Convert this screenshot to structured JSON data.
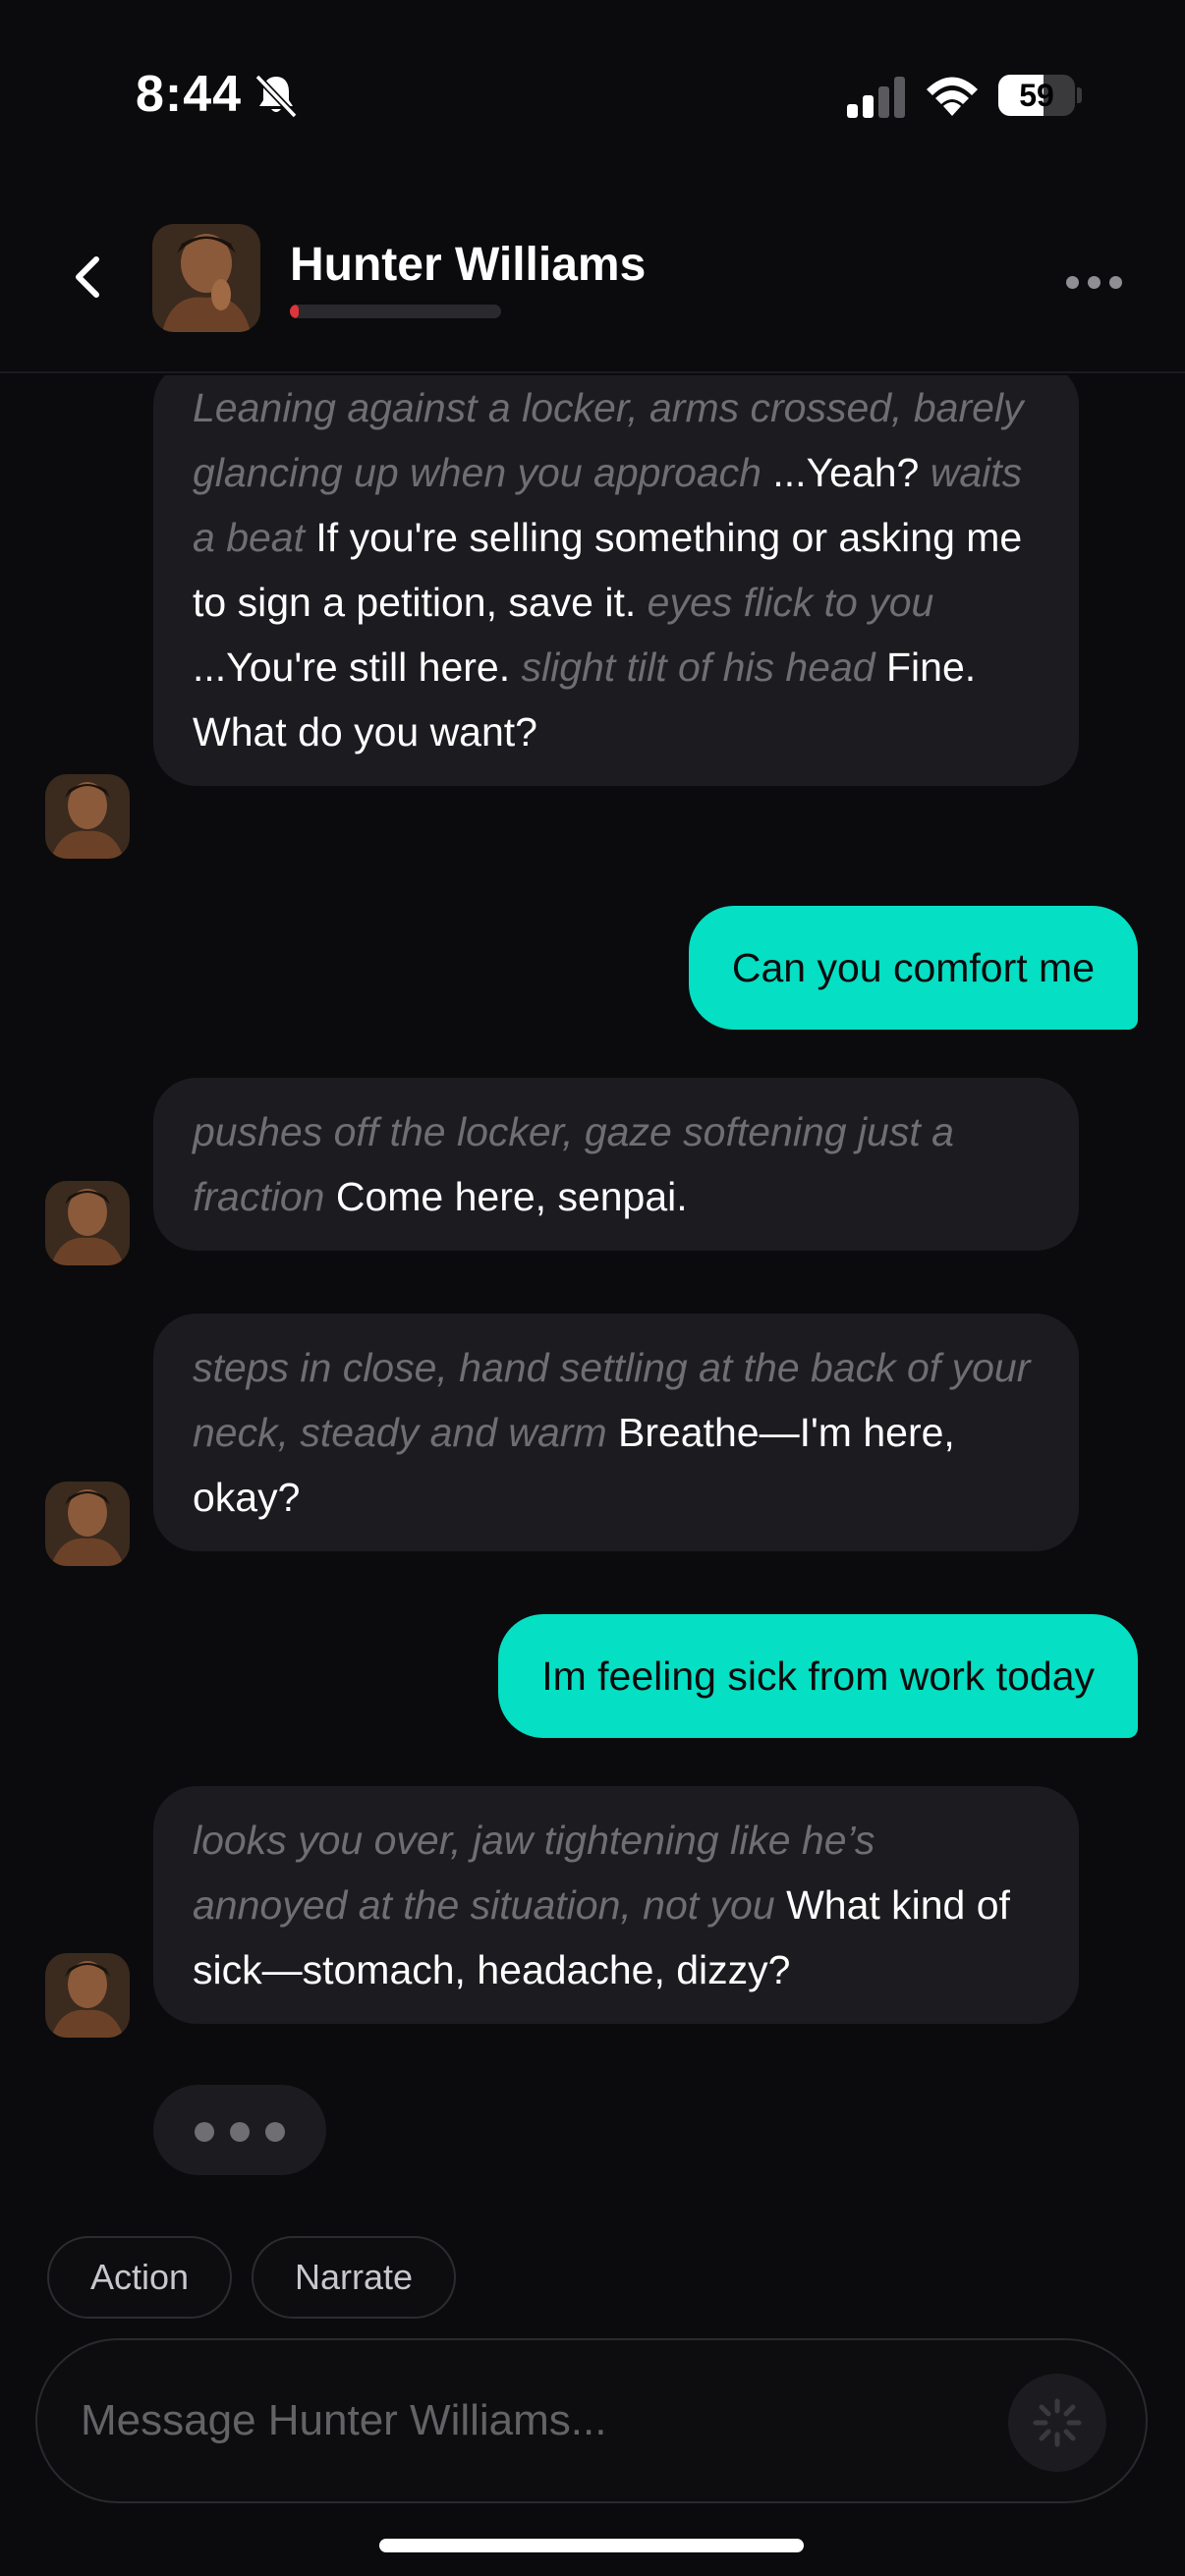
{
  "status_bar": {
    "time": "8:44",
    "battery_level": "59",
    "icons": [
      "bell-slash-icon",
      "cellular-signal-icon",
      "wifi-icon",
      "battery-icon"
    ]
  },
  "header": {
    "contact_name": "Hunter Williams",
    "relationship_progress": 0.04,
    "progress_color": "#e0343a",
    "icons": [
      "chevron-left-icon",
      "more-horizontal-icon"
    ]
  },
  "messages": [
    {
      "sender": "ai",
      "parts": [
        {
          "type": "action",
          "text": "Leaning against a locker, arms crossed, barely glancing up when you approach"
        },
        {
          "type": "speech",
          "text": " ...Yeah? "
        },
        {
          "type": "action",
          "text": "waits a beat"
        },
        {
          "type": "speech",
          "text": " If you're selling something or asking me to sign a petition, save it. "
        },
        {
          "type": "action",
          "text": "eyes flick to you"
        },
        {
          "type": "speech",
          "text": " ...You're still here. "
        },
        {
          "type": "action",
          "text": "slight tilt of his head"
        },
        {
          "type": "speech",
          "text": " Fine. What do you want?"
        }
      ]
    },
    {
      "sender": "user",
      "text": "Can you comfort me"
    },
    {
      "sender": "ai",
      "parts": [
        {
          "type": "action",
          "text": "pushes off the locker, gaze softening just a fraction"
        },
        {
          "type": "speech",
          "text": " Come here, senpai."
        }
      ]
    },
    {
      "sender": "ai",
      "parts": [
        {
          "type": "action",
          "text": "steps in close, hand settling at the back of your neck, steady and warm"
        },
        {
          "type": "speech",
          "text": " Breathe—I'm here, okay?"
        }
      ]
    },
    {
      "sender": "user",
      "text": "Im feeling sick from work today"
    },
    {
      "sender": "ai",
      "parts": [
        {
          "type": "action",
          "text": "looks you over, jaw tightening like he’s annoyed at the situation, not you"
        },
        {
          "type": "speech",
          "text": " What kind of sick—stomach, headache, dizzy?"
        }
      ]
    }
  ],
  "chips": {
    "action_label": "Action",
    "narrate_label": "Narrate"
  },
  "composer": {
    "placeholder": "Message Hunter Williams...",
    "send_icon": "loading-spinner-icon"
  },
  "colors": {
    "background": "#0b0b0d",
    "ai_bubble": "#1c1c20",
    "user_bubble": "#05dfc3",
    "action_text": "#6e6e73"
  }
}
